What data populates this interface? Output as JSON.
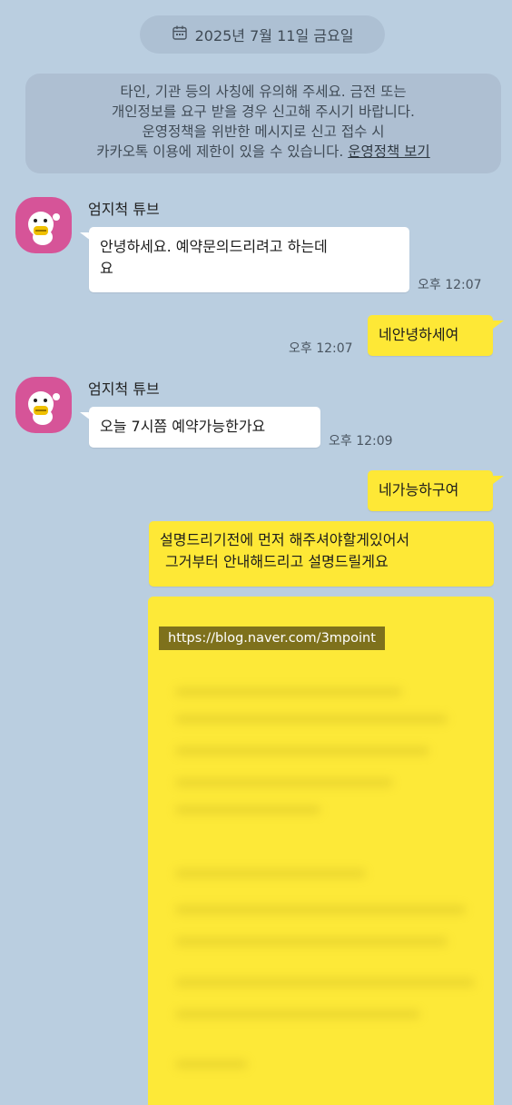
{
  "date_divider": {
    "text": "2025년 7월 11일 금요일",
    "icon": "calendar-icon"
  },
  "notice": {
    "lines": [
      "타인, 기관 등의 사칭에 유의해 주세요. 금전 또는",
      "개인정보를 요구 받을 경우 신고해 주시기 바랍니다.",
      "운영정책을 위반한 메시지로 신고 접수 시",
      "카카오톡 이용에 제한이 있을 수 있습니다."
    ],
    "link_text": "운영정책 보기"
  },
  "messages": [
    {
      "sender": "엄지척 튜브",
      "lines": [
        "안녕하세요. 예약문의드리려고 하는데",
        "요"
      ],
      "time": "오후 12:07"
    },
    {
      "text": "네안녕하세여",
      "time": "오후 12:07"
    },
    {
      "sender": "엄지척 튜브",
      "text": "오늘 7시쯤 예약가능한가요",
      "time": "오후 12:09"
    },
    {
      "text": "네가능하구여"
    },
    {
      "lines": [
        "설명드리기전에 먼저 해주셔야할게있어서",
        "그거부터 안내해드리고 설명드릴게요"
      ]
    }
  ],
  "image_message": {
    "watermark": "https://blog.naver.com/3mpoint"
  },
  "colors": {
    "background": "#bacee0",
    "my_bubble": "#fee836",
    "their_bubble": "#ffffff",
    "avatar": "#d65498"
  }
}
